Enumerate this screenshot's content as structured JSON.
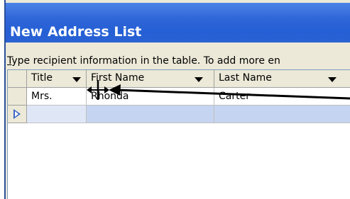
{
  "dialog": {
    "title": "New Address List",
    "instruction_hotkey": "T",
    "instruction_rest": "ype recipient information in the table.  To add more en"
  },
  "table": {
    "columns": [
      {
        "label": "Title"
      },
      {
        "label": "First Name"
      },
      {
        "label": "Last Name"
      }
    ],
    "rows": [
      {
        "title": "Mrs.",
        "first_name": "Rhonda",
        "last_name": "Carter"
      }
    ]
  },
  "colors": {
    "titlebar": "#2f66d8",
    "new_row": "#c5d4f0",
    "annotation_arrow": "#000000"
  },
  "icons": {
    "resize_cursor": "column-resize-cursor-icon",
    "new_row_pointer": "new-record-pointer-icon",
    "dropdown": "dropdown-arrow-icon"
  }
}
